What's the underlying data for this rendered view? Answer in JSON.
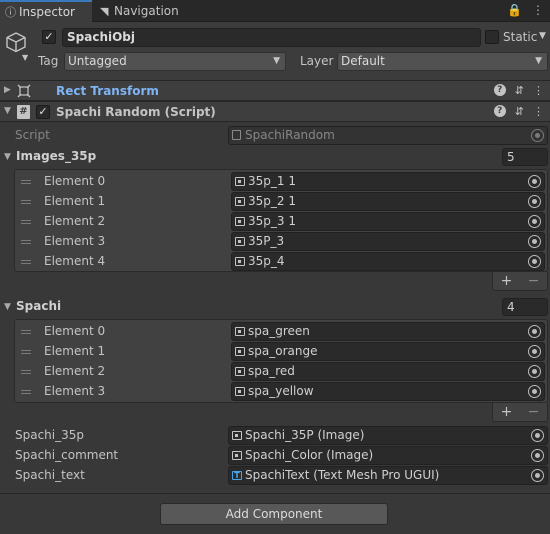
{
  "tabs": [
    {
      "label": "Inspector",
      "icon": "info-icon"
    },
    {
      "label": "Navigation",
      "icon": "navigation-icon"
    }
  ],
  "object": {
    "active": true,
    "name": "SpachiObj",
    "static_label": "Static",
    "static": false,
    "tag_label": "Tag",
    "tag_value": "Untagged",
    "layer_label": "Layer",
    "layer_value": "Default"
  },
  "components": {
    "rect_transform": {
      "title": "Rect Transform"
    },
    "spachi_random": {
      "title": "Spachi Random (Script)",
      "enabled": true,
      "script_label": "Script",
      "script_value": "SpachiRandom",
      "images": {
        "label": "Images_35p",
        "size": "5",
        "elements": [
          {
            "label": "Element 0",
            "value": "35p_1 1"
          },
          {
            "label": "Element 1",
            "value": "35p_2 1"
          },
          {
            "label": "Element 2",
            "value": "35p_3 1"
          },
          {
            "label": "Element 3",
            "value": "35P_3"
          },
          {
            "label": "Element 4",
            "value": "35p_4"
          }
        ]
      },
      "spachi": {
        "label": "Spachi",
        "size": "4",
        "elements": [
          {
            "label": "Element 0",
            "value": "spa_green"
          },
          {
            "label": "Element 1",
            "value": "spa_orange"
          },
          {
            "label": "Element 2",
            "value": "spa_red"
          },
          {
            "label": "Element 3",
            "value": "spa_yellow"
          }
        ]
      },
      "fields": [
        {
          "label": "Spachi_35p",
          "value": "Spachi_35P (Image)",
          "icon": "image-icon"
        },
        {
          "label": "Spachi_comment",
          "value": "Spachi_Color (Image)",
          "icon": "image-icon"
        },
        {
          "label": "Spachi_text",
          "value": "SpachiText (Text Mesh Pro UGUI)",
          "icon": "textmeshpro-icon"
        }
      ]
    }
  },
  "list_buttons": {
    "add": "+",
    "remove": "−"
  },
  "add_component": "Add Component",
  "colors": {
    "background": "#383838",
    "header": "#3e3e3e",
    "link": "#7fb4f5",
    "accent": "#3a79bb"
  }
}
